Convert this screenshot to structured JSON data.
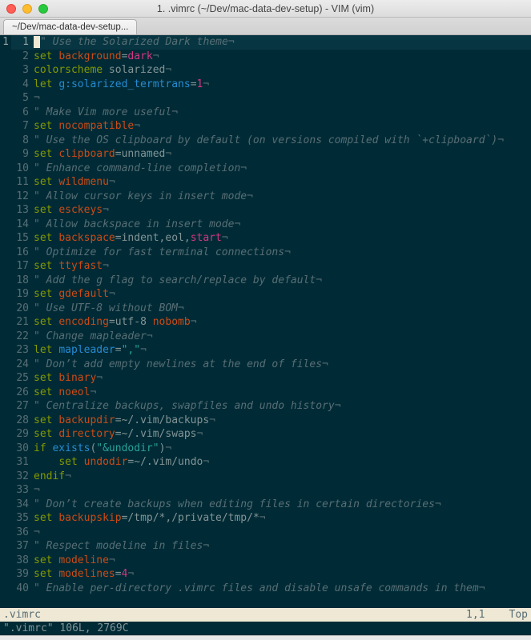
{
  "window": {
    "title": "1. .vimrc (~/Dev/mac-data-dev-setup) - VIM (vim)",
    "tab_label": "~/Dev/mac-data-dev-setup..."
  },
  "editor": {
    "fold_marker": "1",
    "current_line_index": 0,
    "lines": [
      [
        {
          "t": "comment",
          "s": "\" Use the Solarized Dark theme"
        }
      ],
      [
        {
          "t": "key",
          "s": "set"
        },
        {
          "t": "punct",
          "s": " "
        },
        {
          "t": "opt",
          "s": "background"
        },
        {
          "t": "punct",
          "s": "="
        },
        {
          "t": "num",
          "s": "dark"
        }
      ],
      [
        {
          "t": "key",
          "s": "colorscheme"
        },
        {
          "t": "punct",
          "s": " solarized"
        }
      ],
      [
        {
          "t": "key",
          "s": "let"
        },
        {
          "t": "punct",
          "s": " "
        },
        {
          "t": "ident",
          "s": "g:solarized_termtrans"
        },
        {
          "t": "punct",
          "s": "="
        },
        {
          "t": "num",
          "s": "1"
        }
      ],
      [],
      [
        {
          "t": "comment",
          "s": "\" Make Vim more useful"
        }
      ],
      [
        {
          "t": "key",
          "s": "set"
        },
        {
          "t": "punct",
          "s": " "
        },
        {
          "t": "opt",
          "s": "nocompatible"
        }
      ],
      [
        {
          "t": "comment",
          "s": "\" Use the OS clipboard by default (on versions compiled with `+clipboard`)"
        }
      ],
      [
        {
          "t": "key",
          "s": "set"
        },
        {
          "t": "punct",
          "s": " "
        },
        {
          "t": "opt",
          "s": "clipboard"
        },
        {
          "t": "punct",
          "s": "=unnamed"
        }
      ],
      [
        {
          "t": "comment",
          "s": "\" Enhance command-line completion"
        }
      ],
      [
        {
          "t": "key",
          "s": "set"
        },
        {
          "t": "punct",
          "s": " "
        },
        {
          "t": "opt",
          "s": "wildmenu"
        }
      ],
      [
        {
          "t": "comment",
          "s": "\" Allow cursor keys in insert mode"
        }
      ],
      [
        {
          "t": "key",
          "s": "set"
        },
        {
          "t": "punct",
          "s": " "
        },
        {
          "t": "opt",
          "s": "esckeys"
        }
      ],
      [
        {
          "t": "comment",
          "s": "\" Allow backspace in insert mode"
        }
      ],
      [
        {
          "t": "key",
          "s": "set"
        },
        {
          "t": "punct",
          "s": " "
        },
        {
          "t": "opt",
          "s": "backspace"
        },
        {
          "t": "punct",
          "s": "=indent,eol,"
        },
        {
          "t": "num",
          "s": "start"
        }
      ],
      [
        {
          "t": "comment",
          "s": "\" Optimize for fast terminal connections"
        }
      ],
      [
        {
          "t": "key",
          "s": "set"
        },
        {
          "t": "punct",
          "s": " "
        },
        {
          "t": "opt",
          "s": "ttyfast"
        }
      ],
      [
        {
          "t": "comment",
          "s": "\" Add the g flag to search/replace by default"
        }
      ],
      [
        {
          "t": "key",
          "s": "set"
        },
        {
          "t": "punct",
          "s": " "
        },
        {
          "t": "opt",
          "s": "gdefault"
        }
      ],
      [
        {
          "t": "comment",
          "s": "\" Use UTF-8 without BOM"
        }
      ],
      [
        {
          "t": "key",
          "s": "set"
        },
        {
          "t": "punct",
          "s": " "
        },
        {
          "t": "opt",
          "s": "encoding"
        },
        {
          "t": "punct",
          "s": "=utf-8 "
        },
        {
          "t": "opt",
          "s": "nobomb"
        }
      ],
      [
        {
          "t": "comment",
          "s": "\" Change mapleader"
        }
      ],
      [
        {
          "t": "key",
          "s": "let"
        },
        {
          "t": "punct",
          "s": " "
        },
        {
          "t": "ident",
          "s": "mapleader"
        },
        {
          "t": "punct",
          "s": "="
        },
        {
          "t": "str",
          "s": "\",\""
        }
      ],
      [
        {
          "t": "comment",
          "s": "\" Don’t add empty newlines at the end of files"
        }
      ],
      [
        {
          "t": "key",
          "s": "set"
        },
        {
          "t": "punct",
          "s": " "
        },
        {
          "t": "opt",
          "s": "binary"
        }
      ],
      [
        {
          "t": "key",
          "s": "set"
        },
        {
          "t": "punct",
          "s": " "
        },
        {
          "t": "opt",
          "s": "noeol"
        }
      ],
      [
        {
          "t": "comment",
          "s": "\" Centralize backups, swapfiles and undo history"
        }
      ],
      [
        {
          "t": "key",
          "s": "set"
        },
        {
          "t": "punct",
          "s": " "
        },
        {
          "t": "opt",
          "s": "backupdir"
        },
        {
          "t": "punct",
          "s": "=~/.vim/backups"
        }
      ],
      [
        {
          "t": "key",
          "s": "set"
        },
        {
          "t": "punct",
          "s": " "
        },
        {
          "t": "opt",
          "s": "directory"
        },
        {
          "t": "punct",
          "s": "=~/.vim/swaps"
        }
      ],
      [
        {
          "t": "key",
          "s": "if"
        },
        {
          "t": "punct",
          "s": " "
        },
        {
          "t": "ident",
          "s": "exists"
        },
        {
          "t": "punct",
          "s": "("
        },
        {
          "t": "str",
          "s": "\"&undodir\""
        },
        {
          "t": "punct",
          "s": ")"
        }
      ],
      [
        {
          "t": "punct",
          "s": "    "
        },
        {
          "t": "key",
          "s": "set"
        },
        {
          "t": "punct",
          "s": " "
        },
        {
          "t": "opt",
          "s": "undodir"
        },
        {
          "t": "punct",
          "s": "=~/.vim/undo"
        }
      ],
      [
        {
          "t": "key",
          "s": "endif"
        }
      ],
      [],
      [
        {
          "t": "comment",
          "s": "\" Don’t create backups when editing files in certain directories"
        }
      ],
      [
        {
          "t": "key",
          "s": "set"
        },
        {
          "t": "punct",
          "s": " "
        },
        {
          "t": "opt",
          "s": "backupskip"
        },
        {
          "t": "punct",
          "s": "=/tmp/*,/private/tmp/*"
        }
      ],
      [],
      [
        {
          "t": "comment",
          "s": "\" Respect modeline in files"
        }
      ],
      [
        {
          "t": "key",
          "s": "set"
        },
        {
          "t": "punct",
          "s": " "
        },
        {
          "t": "opt",
          "s": "modeline"
        }
      ],
      [
        {
          "t": "key",
          "s": "set"
        },
        {
          "t": "punct",
          "s": " "
        },
        {
          "t": "opt",
          "s": "modelines"
        },
        {
          "t": "punct",
          "s": "="
        },
        {
          "t": "num",
          "s": "4"
        }
      ],
      [
        {
          "t": "comment",
          "s": "\" Enable per-directory .vimrc files and disable unsafe commands in them"
        }
      ]
    ],
    "eol_char": "¬"
  },
  "statusline": {
    "filename": ".vimrc",
    "position": "1,1",
    "percent": "Top"
  },
  "cmdline": "\".vimrc\" 106L, 2769C"
}
